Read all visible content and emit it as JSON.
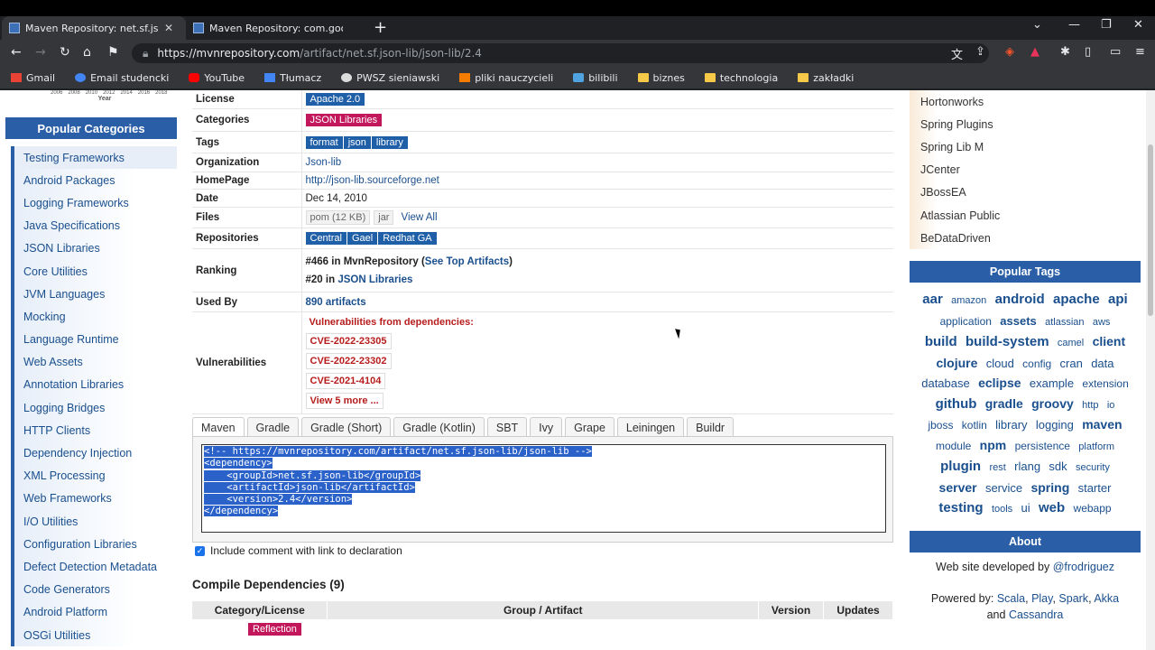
{
  "browser": {
    "tabs": [
      {
        "title": "Maven Repository: net.sf.json-lib",
        "active": true
      },
      {
        "title": "Maven Repository: com.google.code.g",
        "active": false
      }
    ],
    "url_host": "https://mvnrepository.com",
    "url_path": "/artifact/net.sf.json-lib/json-lib/2.4",
    "bookmarks": [
      "Gmail",
      "Email studencki",
      "YouTube",
      "Tłumacz",
      "PWSZ sieniawski",
      "pliki nauczycieli",
      "bilibili",
      "biznes",
      "technologia",
      "zakładki"
    ]
  },
  "left": {
    "chart_label": "Year",
    "chart_years": [
      "2006",
      "2008",
      "2010",
      "2012",
      "2014",
      "2016",
      "2018"
    ],
    "header": "Popular Categories",
    "items": [
      "Testing Frameworks",
      "Android Packages",
      "Logging Frameworks",
      "Java Specifications",
      "JSON Libraries",
      "Core Utilities",
      "JVM Languages",
      "Mocking",
      "Language Runtime",
      "Web Assets",
      "Annotation Libraries",
      "Logging Bridges",
      "HTTP Clients",
      "Dependency Injection",
      "XML Processing",
      "Web Frameworks",
      "I/O Utilities",
      "Configuration Libraries",
      "Defect Detection Metadata",
      "Code Generators",
      "Android Platform",
      "OSGi Utilities"
    ]
  },
  "info": {
    "license_label": "License",
    "license": "Apache 2.0",
    "categories_label": "Categories",
    "category": "JSON Libraries",
    "tags_label": "Tags",
    "tags": [
      "format",
      "json",
      "library"
    ],
    "org_label": "Organization",
    "org": "Json-lib",
    "homepage_label": "HomePage",
    "homepage": "http://json-lib.sourceforge.net",
    "date_label": "Date",
    "date": "Dec 14, 2010",
    "files_label": "Files",
    "file_pom": "pom (12 KB)",
    "file_jar": "jar",
    "view_all": "View All",
    "repos_label": "Repositories",
    "repos": [
      "Central",
      "Gael",
      "Redhat GA"
    ],
    "ranking_label": "Ranking",
    "rank1_prefix": "#466 in MvnRepository (",
    "rank1_link": "See Top Artifacts",
    "rank1_suffix": ")",
    "rank2_prefix": "#20 in ",
    "rank2_link": "JSON Libraries",
    "usedby_label": "Used By",
    "usedby": "890 artifacts",
    "vuln_label": "Vulnerabilities",
    "vuln_head": "Vulnerabilities from dependencies:",
    "cves": [
      "CVE-2022-23305",
      "CVE-2022-23302",
      "CVE-2021-4104"
    ],
    "view_more": "View 5 more ..."
  },
  "build_tabs": [
    "Maven",
    "Gradle",
    "Gradle (Short)",
    "Gradle (Kotlin)",
    "SBT",
    "Ivy",
    "Grape",
    "Leiningen",
    "Buildr"
  ],
  "code_lines": [
    "<!-- https://mvnrepository.com/artifact/net.sf.json-lib/json-lib -->",
    "<dependency>",
    "    <groupId>net.sf.json-lib</groupId>",
    "    <artifactId>json-lib</artifactId>",
    "    <version>2.4</version>",
    "</dependency>"
  ],
  "include_comment": "Include comment with link to declaration",
  "compile_title": "Compile Dependencies (9)",
  "dep_headers": [
    "Category/License",
    "Group / Artifact",
    "Version",
    "Updates"
  ],
  "dep_first_category": "Reflection",
  "right": {
    "repos": [
      "Hortonworks",
      "Spring Plugins",
      "Spring Lib M",
      "JCenter",
      "JBossEA",
      "Atlassian Public",
      "BeDataDriven"
    ],
    "tags_header": "Popular Tags",
    "tags": [
      {
        "t": "aar",
        "s": 15,
        "b": true
      },
      {
        "t": "amazon",
        "s": 11,
        "b": false
      },
      {
        "t": "android",
        "s": 15,
        "b": true
      },
      {
        "t": "apache",
        "s": 15,
        "b": true
      },
      {
        "t": "api",
        "s": 15,
        "b": true
      },
      {
        "t": "application",
        "s": 12,
        "b": false
      },
      {
        "t": "assets",
        "s": 13,
        "b": true
      },
      {
        "t": "atlassian",
        "s": 11,
        "b": false
      },
      {
        "t": "aws",
        "s": 11,
        "b": false
      },
      {
        "t": "build",
        "s": 15,
        "b": true
      },
      {
        "t": "build-system",
        "s": 15,
        "b": true
      },
      {
        "t": "camel",
        "s": 11,
        "b": false
      },
      {
        "t": "client",
        "s": 14,
        "b": true
      },
      {
        "t": "clojure",
        "s": 14,
        "b": true
      },
      {
        "t": "cloud",
        "s": 13,
        "b": false
      },
      {
        "t": "config",
        "s": 12,
        "b": false
      },
      {
        "t": "cran",
        "s": 13,
        "b": false
      },
      {
        "t": "data",
        "s": 13,
        "b": false
      },
      {
        "t": "database",
        "s": 13,
        "b": false
      },
      {
        "t": "eclipse",
        "s": 14,
        "b": true
      },
      {
        "t": "example",
        "s": 13,
        "b": false
      },
      {
        "t": "extension",
        "s": 12,
        "b": false
      },
      {
        "t": "github",
        "s": 15,
        "b": true
      },
      {
        "t": "gradle",
        "s": 14,
        "b": true
      },
      {
        "t": "groovy",
        "s": 14,
        "b": true
      },
      {
        "t": "http",
        "s": 11,
        "b": false
      },
      {
        "t": "io",
        "s": 11,
        "b": false
      },
      {
        "t": "jboss",
        "s": 12,
        "b": false
      },
      {
        "t": "kotlin",
        "s": 12,
        "b": false
      },
      {
        "t": "library",
        "s": 13,
        "b": false
      },
      {
        "t": "logging",
        "s": 13,
        "b": false
      },
      {
        "t": "maven",
        "s": 14,
        "b": true
      },
      {
        "t": "module",
        "s": 12,
        "b": false
      },
      {
        "t": "npm",
        "s": 14,
        "b": true
      },
      {
        "t": "persistence",
        "s": 12,
        "b": false
      },
      {
        "t": "platform",
        "s": 11,
        "b": false
      },
      {
        "t": "plugin",
        "s": 15,
        "b": true
      },
      {
        "t": "rest",
        "s": 11,
        "b": false
      },
      {
        "t": "rlang",
        "s": 13,
        "b": false
      },
      {
        "t": "sdk",
        "s": 13,
        "b": false
      },
      {
        "t": "security",
        "s": 11,
        "b": false
      },
      {
        "t": "server",
        "s": 14,
        "b": true
      },
      {
        "t": "service",
        "s": 13,
        "b": false
      },
      {
        "t": "spring",
        "s": 14,
        "b": true
      },
      {
        "t": "starter",
        "s": 13,
        "b": false
      },
      {
        "t": "testing",
        "s": 15,
        "b": true
      },
      {
        "t": "tools",
        "s": 11,
        "b": false
      },
      {
        "t": "ui",
        "s": 13,
        "b": false
      },
      {
        "t": "web",
        "s": 15,
        "b": true
      },
      {
        "t": "webapp",
        "s": 12,
        "b": false
      }
    ],
    "about_header": "About",
    "about_text": "Web site developed by ",
    "about_link": "@frodriguez",
    "powered_prefix": "Powered by: ",
    "powered_links": [
      "Scala",
      "Play",
      "Spark",
      "Akka"
    ],
    "powered_and": " and ",
    "powered_last": "Cassandra"
  }
}
